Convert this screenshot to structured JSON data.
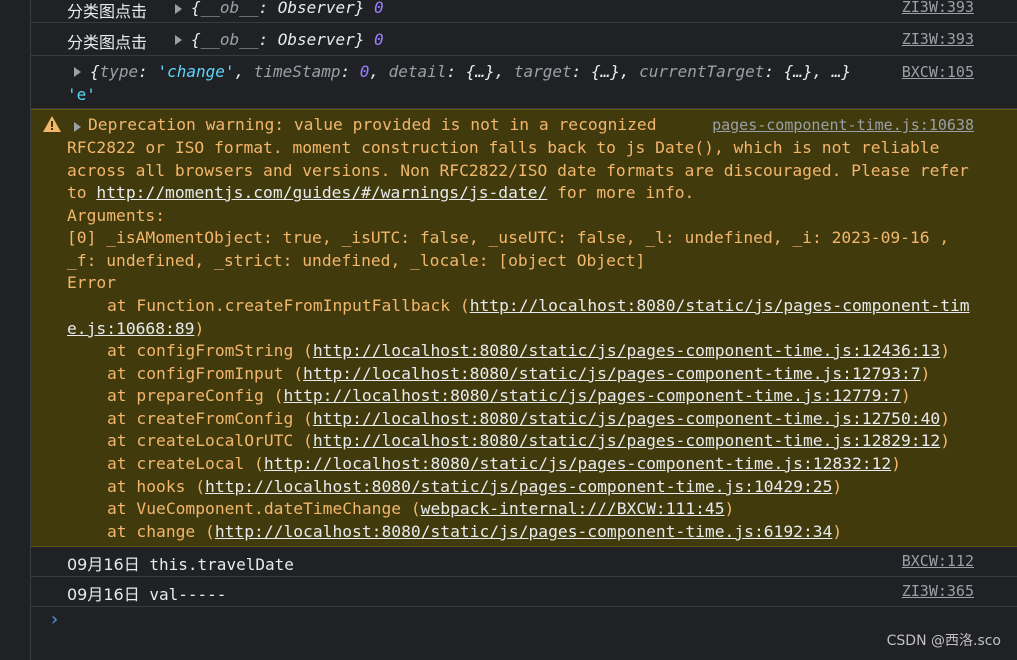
{
  "log1": {
    "label": "分类图点击",
    "object_open": "{",
    "key": "__ob__",
    "colon": ": ",
    "value": "Observer",
    "object_close": "}",
    "num": "0",
    "source": "ZI3W:393"
  },
  "log2": {
    "label": "分类图点击",
    "object_open": "{",
    "key": "__ob__",
    "colon": ": ",
    "value": "Observer",
    "object_close": "}",
    "num": "0",
    "source": "ZI3W:393"
  },
  "log3": {
    "open": "{",
    "k_type": "type",
    "v_type": "'change'",
    "k_ts": "timeStamp",
    "v_ts": "0",
    "k_detail": "detail",
    "v_detail": "{…}",
    "k_target": "target",
    "v_target": "{…}",
    "k_ct": "currentTarget",
    "v_ct": "{…}",
    "more": "…}",
    "second_line": "'e'",
    "source": "BXCW:105"
  },
  "warning": {
    "line1": "Deprecation warning: value provided is not in a recognized",
    "source": "pages-component-time.js:10638",
    "line2": "RFC2822 or ISO format. moment construction falls back to js Date(), which is not reliable",
    "line3": "across all browsers and versions. Non RFC2822/ISO date formats are discouraged. Please refer",
    "line4_pre": "to ",
    "line4_link": "http://momentjs.com/guides/#/warnings/js-date/",
    "line4_post": " for more info.",
    "line5": "Arguments:",
    "line6": "[0] _isAMomentObject: true, _isUTC: false, _useUTC: false, _l: undefined, _i: 2023-09-16 ,",
    "line7": "_f: undefined, _strict: undefined, _locale: [object Object]",
    "line8": "Error",
    "stack": [
      {
        "fn": "at Function.createFromInputFallback (",
        "url": "http://localhost:8080/static/js/pages-component-tim",
        "url2": "e.js:10668:89",
        "end": ")"
      },
      {
        "fn": "at configFromString (",
        "url": "http://localhost:8080/static/js/pages-component-time.js:12436:13",
        "end": ")"
      },
      {
        "fn": "at configFromInput (",
        "url": "http://localhost:8080/static/js/pages-component-time.js:12793:7",
        "end": ")"
      },
      {
        "fn": "at prepareConfig (",
        "url": "http://localhost:8080/static/js/pages-component-time.js:12779:7",
        "end": ")"
      },
      {
        "fn": "at createFromConfig (",
        "url": "http://localhost:8080/static/js/pages-component-time.js:12750:40",
        "end": ")"
      },
      {
        "fn": "at createLocalOrUTC (",
        "url": "http://localhost:8080/static/js/pages-component-time.js:12829:12",
        "end": ")"
      },
      {
        "fn": "at createLocal (",
        "url": "http://localhost:8080/static/js/pages-component-time.js:12832:12",
        "end": ")"
      },
      {
        "fn": "at hooks (",
        "url": "http://localhost:8080/static/js/pages-component-time.js:10429:25",
        "end": ")"
      },
      {
        "fn": "at VueComponent.dateTimeChange (",
        "url": "webpack-internal:///BXCW:111:45",
        "end": ")"
      },
      {
        "fn": "at change (",
        "url": "http://localhost:8080/static/js/pages-component-time.js:6192:34",
        "end": ")"
      }
    ]
  },
  "log4": {
    "date": "09月16日",
    "text": "this.travelDate",
    "source": "BXCW:112"
  },
  "log5": {
    "date": "09月16日",
    "text": "val-----",
    "source": "ZI3W:365"
  },
  "prompt": "›",
  "watermark": "CSDN @西洛.sco",
  "colors": {
    "background": "#202124",
    "warning_bg": "#413a0d",
    "warning_text": "#f2b66d",
    "string": "#5cd5fb",
    "number": "#9980ff"
  }
}
